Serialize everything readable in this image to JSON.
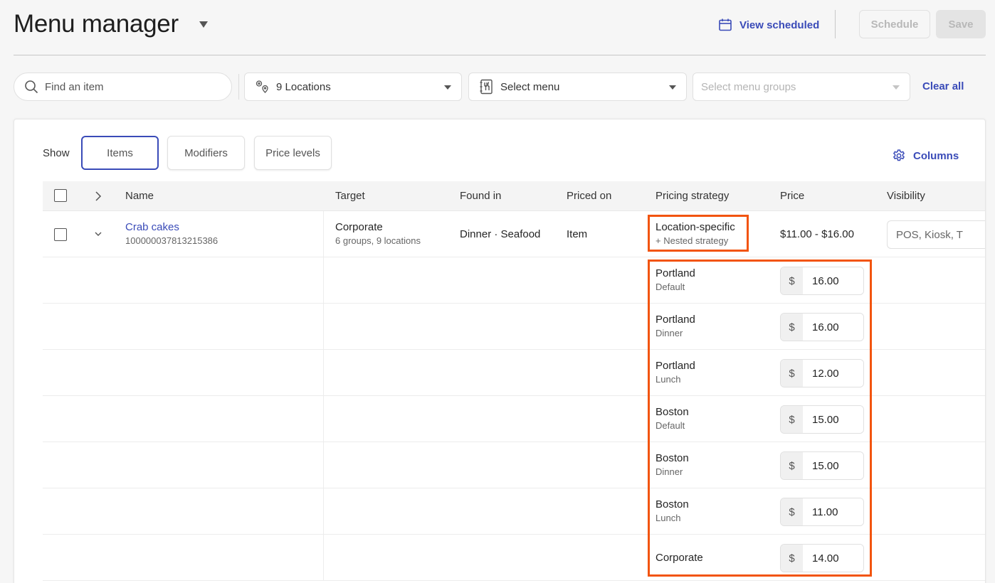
{
  "header": {
    "title": "Menu manager",
    "view_scheduled": "View scheduled",
    "schedule_label": "Schedule",
    "save_label": "Save"
  },
  "filters": {
    "search_placeholder": "Find an item",
    "locations": "9 Locations",
    "menu_placeholder": "Select menu",
    "menu_groups_placeholder": "Select menu groups",
    "clear_all": "Clear all"
  },
  "show": {
    "label": "Show",
    "options": [
      "Items",
      "Modifiers",
      "Price levels"
    ],
    "active": "Items"
  },
  "columns_label": "Columns",
  "table": {
    "headers": {
      "name": "Name",
      "target": "Target",
      "found_in": "Found in",
      "priced_on": "Priced on",
      "pricing_strategy": "Pricing strategy",
      "price": "Price",
      "visibility": "Visibility"
    },
    "item": {
      "name": "Crab cakes",
      "id": "100000037813215386",
      "target": "Corporate",
      "target_sub": "6 groups, 9 locations",
      "found_in": "Dinner · Seafood",
      "priced_on": "Item",
      "pricing_strategy": "Location-specific",
      "pricing_strategy_sub": "+ Nested strategy",
      "price": "$11.00 - $16.00",
      "visibility": "POS, Kiosk, T"
    },
    "location_prices": [
      {
        "location": "Portland",
        "sub": "Default",
        "currency": "$",
        "price": "16.00"
      },
      {
        "location": "Portland",
        "sub": "Dinner",
        "currency": "$",
        "price": "16.00"
      },
      {
        "location": "Portland",
        "sub": "Lunch",
        "currency": "$",
        "price": "12.00"
      },
      {
        "location": "Boston",
        "sub": "Default",
        "currency": "$",
        "price": "15.00"
      },
      {
        "location": "Boston",
        "sub": "Dinner",
        "currency": "$",
        "price": "15.00"
      },
      {
        "location": "Boston",
        "sub": "Lunch",
        "currency": "$",
        "price": "11.00"
      },
      {
        "location": "Corporate",
        "sub": "",
        "currency": "$",
        "price": "14.00"
      }
    ]
  },
  "colors": {
    "accent": "#3a4bb8",
    "highlight": "#f2540f"
  }
}
